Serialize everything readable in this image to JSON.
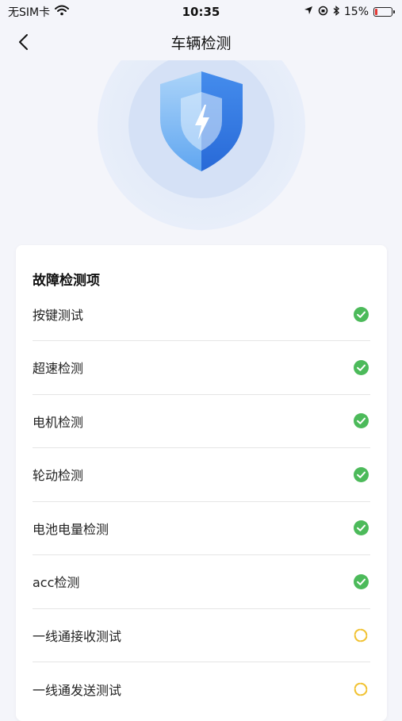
{
  "status_bar": {
    "carrier": "无SIM卡",
    "time": "10:35",
    "battery_text": "15%",
    "battery_level": 0.15
  },
  "nav": {
    "title": "车辆检测"
  },
  "card": {
    "title": "故障检测项",
    "items": [
      {
        "label": "按键测试",
        "status": "passed",
        "icon": "check-circle-icon"
      },
      {
        "label": "超速检测",
        "status": "passed",
        "icon": "check-circle-icon"
      },
      {
        "label": "电机检测",
        "status": "passed",
        "icon": "check-circle-icon"
      },
      {
        "label": "轮动检测",
        "status": "passed",
        "icon": "check-circle-icon"
      },
      {
        "label": "电池电量检测",
        "status": "passed",
        "icon": "check-circle-icon"
      },
      {
        "label": "acc检测",
        "status": "passed",
        "icon": "check-circle-icon"
      },
      {
        "label": "一线通接收测试",
        "status": "in-progress",
        "icon": "loading-icon"
      },
      {
        "label": "一线通发送测试",
        "status": "in-progress",
        "icon": "loading-icon"
      }
    ]
  },
  "colors": {
    "passed": "#4cba5a",
    "in_progress": "#f1c232",
    "shield_light": "#8ec3f5",
    "shield_dark": "#2f7be6"
  }
}
